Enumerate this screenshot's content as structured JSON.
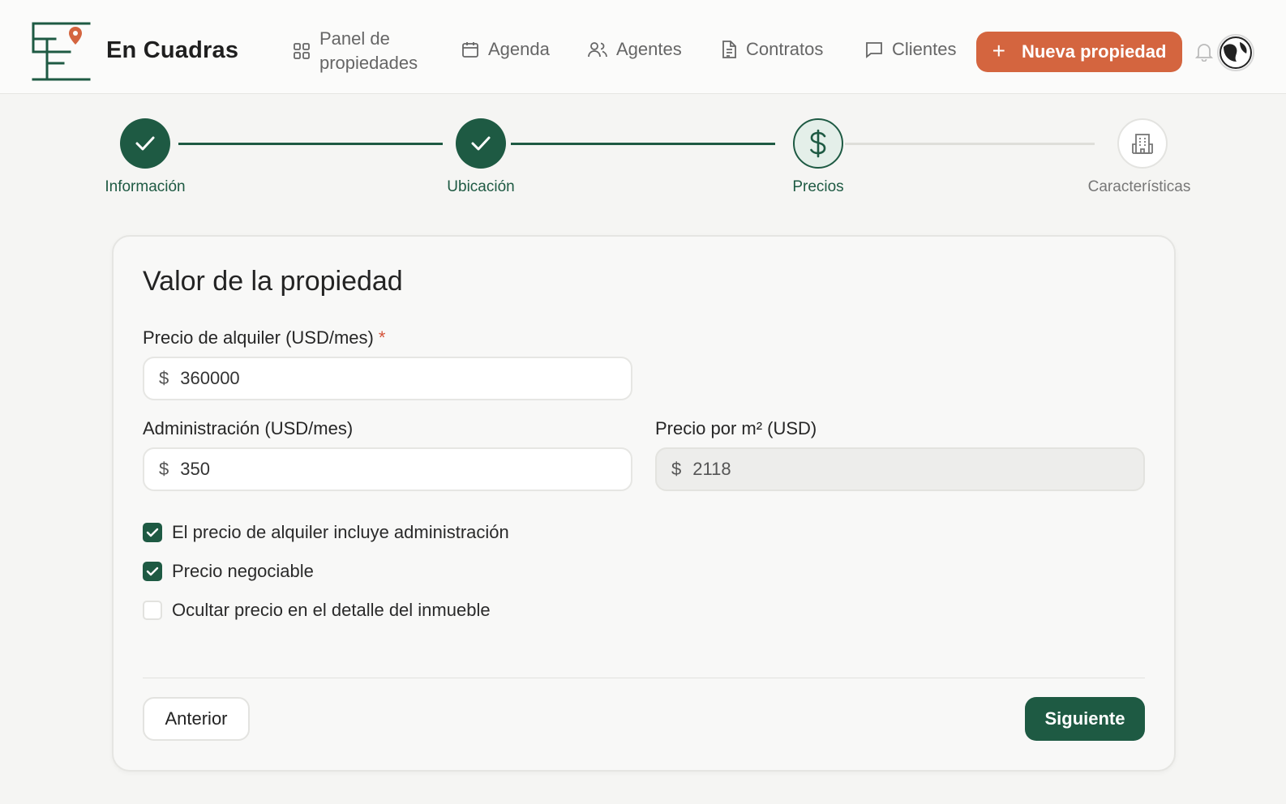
{
  "app": {
    "brand": "En Cuadras"
  },
  "nav": {
    "panel_line1": "Panel de",
    "panel_line2": "propiedades",
    "agenda": "Agenda",
    "agentes": "Agentes",
    "contratos": "Contratos",
    "clientes": "Clientes",
    "new_property": "Nueva propiedad"
  },
  "stepper": {
    "steps": [
      {
        "label": "Información",
        "state": "completed"
      },
      {
        "label": "Ubicación",
        "state": "completed"
      },
      {
        "label": "Precios",
        "state": "current",
        "icon": "dollar-icon"
      },
      {
        "label": "Características",
        "state": "pending",
        "icon": "building-icon"
      }
    ]
  },
  "form": {
    "title": "Valor de la propiedad",
    "rent_price": {
      "label": "Precio de alquiler (USD/mes)",
      "required_mark": "*",
      "currency": "$",
      "value": "360000"
    },
    "administration": {
      "label": "Administración (USD/mes)",
      "currency": "$",
      "value": "350"
    },
    "price_per_m2": {
      "label": "Precio por m² (USD)",
      "currency": "$",
      "value": "2118"
    },
    "checkboxes": [
      {
        "label": "El precio de alquiler incluye administración",
        "checked": true
      },
      {
        "label": "Precio negociable",
        "checked": true
      },
      {
        "label": "Ocultar precio en el detalle del inmueble",
        "checked": false
      }
    ],
    "prev_label": "Anterior",
    "next_label": "Siguiente"
  },
  "colors": {
    "primary": "#1e5a43",
    "accent": "#d4653f",
    "background": "#f5f5f3"
  }
}
